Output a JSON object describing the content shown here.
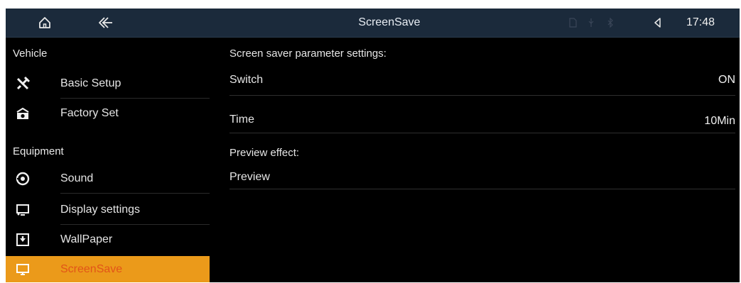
{
  "header": {
    "title": "ScreenSave",
    "time": "17:48",
    "icons": [
      "home-icon",
      "back-icon",
      "sd-card-icon",
      "usb-icon",
      "bluetooth-icon",
      "volume-icon"
    ]
  },
  "sidebar": {
    "sections": [
      {
        "label": "Vehicle"
      },
      {
        "label": "Equipment"
      }
    ],
    "items": [
      {
        "label": "Basic Setup",
        "icon": "tools-icon"
      },
      {
        "label": "Factory Set",
        "icon": "factory-icon"
      },
      {
        "label": "Sound",
        "icon": "speaker-icon"
      },
      {
        "label": "Display settings",
        "icon": "monitor-icon"
      },
      {
        "label": "WallPaper",
        "icon": "wallpaper-icon"
      },
      {
        "label": "ScreenSave",
        "icon": "screen-icon",
        "active": true
      }
    ]
  },
  "main": {
    "heading": "Screen saver parameter settings:",
    "rows": [
      {
        "label": "Switch",
        "value": "ON"
      },
      {
        "label": "Time",
        "value": "10Min"
      }
    ],
    "preview_heading": "Preview effect:",
    "preview_label": "Preview"
  },
  "colors": {
    "topbar": "#1b2a3b",
    "accent": "#eb9a1a",
    "active_text": "#e25418",
    "background": "#000000"
  }
}
